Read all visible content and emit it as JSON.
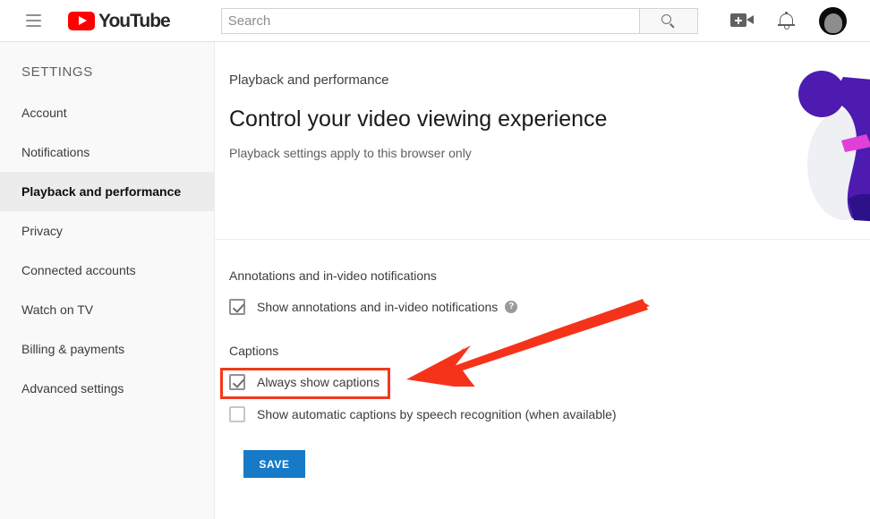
{
  "header": {
    "menu_label": "menu",
    "logo_text": "YouTube",
    "search": {
      "value": "",
      "placeholder": "Search"
    },
    "search_button_label": "",
    "icons": [
      "create-video-icon",
      "notifications-bell-icon",
      "account-avatar"
    ]
  },
  "sidebar": {
    "title": "SETTINGS",
    "items": [
      {
        "label": "Account",
        "active": false
      },
      {
        "label": "Notifications",
        "active": false
      },
      {
        "label": "Playback and performance",
        "active": true
      },
      {
        "label": "Privacy",
        "active": false
      },
      {
        "label": "Connected accounts",
        "active": false
      },
      {
        "label": "Watch on TV",
        "active": false
      },
      {
        "label": "Billing & payments",
        "active": false
      },
      {
        "label": "Advanced settings",
        "active": false
      }
    ]
  },
  "main": {
    "breadcrumb": "Playback and performance",
    "title": "Control your video viewing experience",
    "subtitle": "Playback settings apply to this browser only",
    "sections": [
      {
        "label": "Annotations and in-video notifications",
        "options": [
          {
            "label": "Show annotations and in-video notifications",
            "checked": true,
            "has_help": true,
            "help_glyph": "?"
          }
        ]
      },
      {
        "label": "Captions",
        "options": [
          {
            "label": "Always show captions",
            "checked": true,
            "has_help": false,
            "highlighted": true
          },
          {
            "label": "Show automatic captions by speech recognition (when available)",
            "checked": false,
            "has_help": false
          }
        ]
      }
    ],
    "save_label": "SAVE"
  },
  "annotations": {
    "highlight_color": "#ef3a1b",
    "arrow_color": "#f5331a",
    "arrow_target": "always-show-captions-checkbox"
  },
  "colors": {
    "brand_red": "#ff0000",
    "save_blue": "#167ac6",
    "sidebar_bg": "#f9f9f9",
    "active_item_bg": "#ececec",
    "deco_purple": "#4d1bb0",
    "deco_magenta": "#e040d8"
  }
}
